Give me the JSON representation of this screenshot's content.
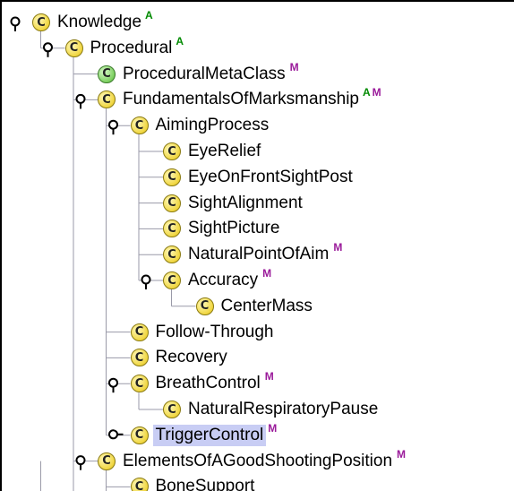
{
  "colors": {
    "badge_a": "#008a00",
    "badge_m": "#9a1a9a",
    "selection": "#c8cdf4",
    "class_icon": "#f0d640",
    "metaclass_icon": "#7cd060"
  },
  "icons": {
    "class": "class-icon (yellow circle with C)",
    "metaclass": "metaclass-icon (green circle with C)",
    "expanded": "expanded-handle-icon",
    "collapsed": "collapsed-handle-icon"
  },
  "tree": {
    "nodes": [
      {
        "label": "Knowledge",
        "icon_letter": "C",
        "badges": [
          "A"
        ]
      },
      {
        "label": "Procedural",
        "icon_letter": "C",
        "badges": [
          "A"
        ]
      },
      {
        "label": "ProceduralMetaClass",
        "icon_letter": "C",
        "badges": [
          "M"
        ]
      },
      {
        "label": "FundamentalsOfMarksmanship",
        "icon_letter": "C",
        "badges": [
          "A",
          "M"
        ]
      },
      {
        "label": "AimingProcess",
        "icon_letter": "C",
        "badges": []
      },
      {
        "label": "EyeRelief",
        "icon_letter": "C",
        "badges": []
      },
      {
        "label": "EyeOnFrontSightPost",
        "icon_letter": "C",
        "badges": []
      },
      {
        "label": "SightAlignment",
        "icon_letter": "C",
        "badges": []
      },
      {
        "label": "SightPicture",
        "icon_letter": "C",
        "badges": []
      },
      {
        "label": "NaturalPointOfAim",
        "icon_letter": "C",
        "badges": [
          "M"
        ]
      },
      {
        "label": "Accuracy",
        "icon_letter": "C",
        "badges": [
          "M"
        ]
      },
      {
        "label": "CenterMass",
        "icon_letter": "C",
        "badges": []
      },
      {
        "label": "Follow-Through",
        "icon_letter": "C",
        "badges": []
      },
      {
        "label": "Recovery",
        "icon_letter": "C",
        "badges": []
      },
      {
        "label": "BreathControl",
        "icon_letter": "C",
        "badges": [
          "M"
        ]
      },
      {
        "label": "NaturalRespiratoryPause",
        "icon_letter": "C",
        "badges": []
      },
      {
        "label": "TriggerControl",
        "icon_letter": "C",
        "badges": [
          "M"
        ],
        "selected": true
      },
      {
        "label": "ElementsOfAGoodShootingPosition",
        "icon_letter": "C",
        "badges": [
          "M"
        ]
      },
      {
        "label": "BoneSupport",
        "icon_letter": "C",
        "badges": []
      }
    ]
  }
}
